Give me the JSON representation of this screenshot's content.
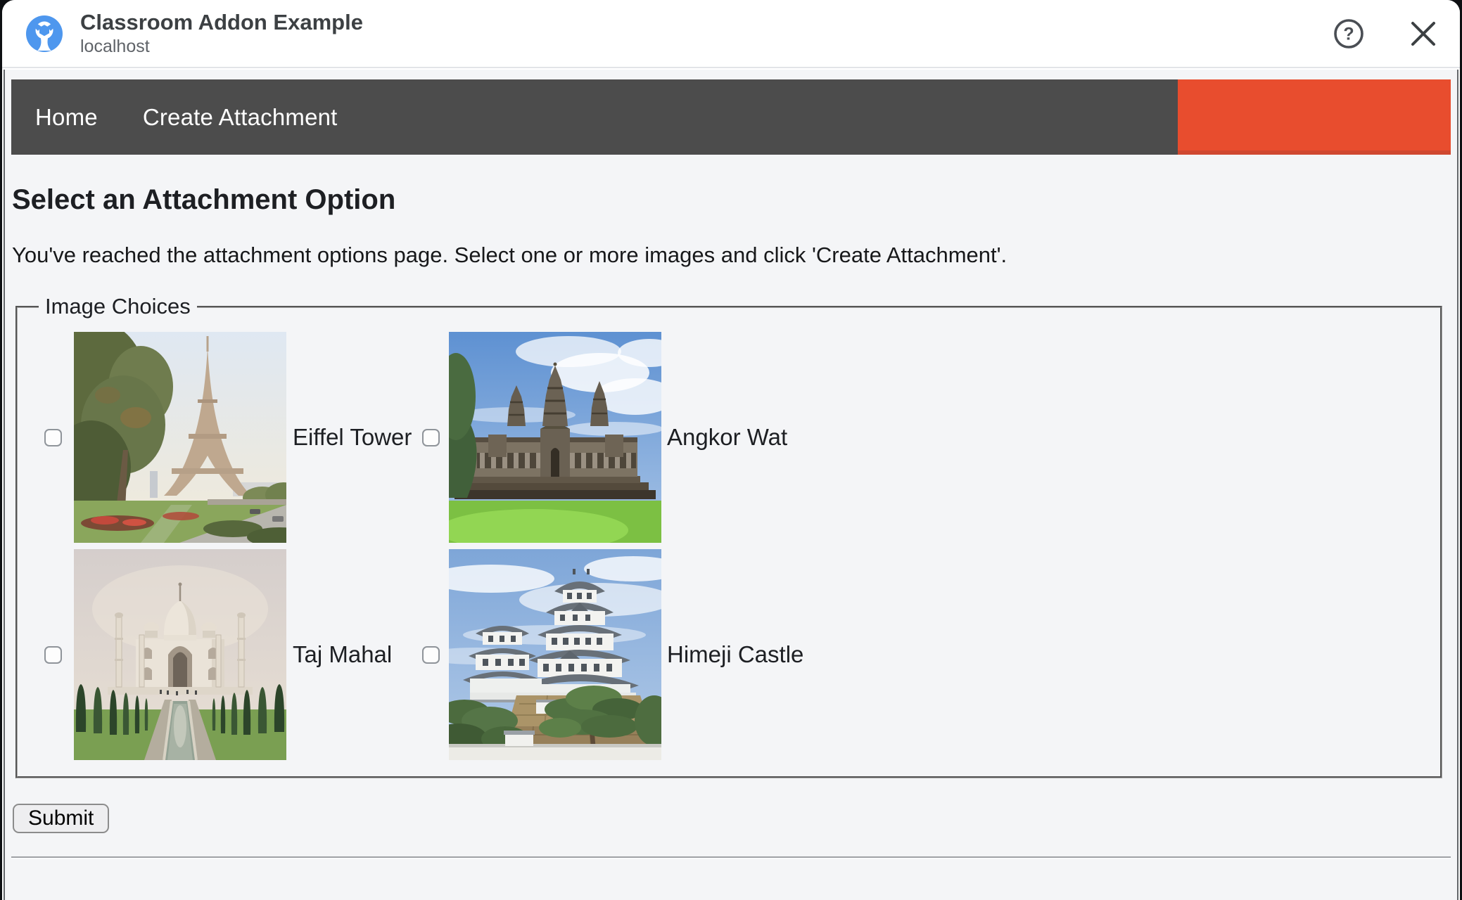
{
  "dialog": {
    "title": "Classroom Addon Example",
    "subtitle": "localhost",
    "help_icon": "circled-question-mark",
    "close_icon": "x-mark",
    "app_icon": "blue-circle-wrench-and-nut"
  },
  "nav": {
    "items": [
      {
        "label": "Home"
      },
      {
        "label": "Create Attachment"
      }
    ]
  },
  "main": {
    "heading": "Select an Attachment Option",
    "intro": "You've reached the attachment options page. Select one or more images and click 'Create Attachment'.",
    "fieldset_legend": "Image Choices",
    "images": [
      {
        "label": "Eiffel Tower",
        "checked": false
      },
      {
        "label": "Angkor Wat",
        "checked": false
      },
      {
        "label": "Taj Mahal",
        "checked": false
      },
      {
        "label": "Himeji Castle",
        "checked": false
      }
    ],
    "submit_label": "Submit"
  },
  "colors": {
    "nav-bg": "#4c4c4c",
    "accent-orange": "#e84d2e",
    "accent-orange-dark": "#cf4830",
    "page-bg": "#f4f5f7",
    "header-bg": "#ffffff",
    "text-dark": "#202124",
    "text-gray": "#5f6368"
  }
}
